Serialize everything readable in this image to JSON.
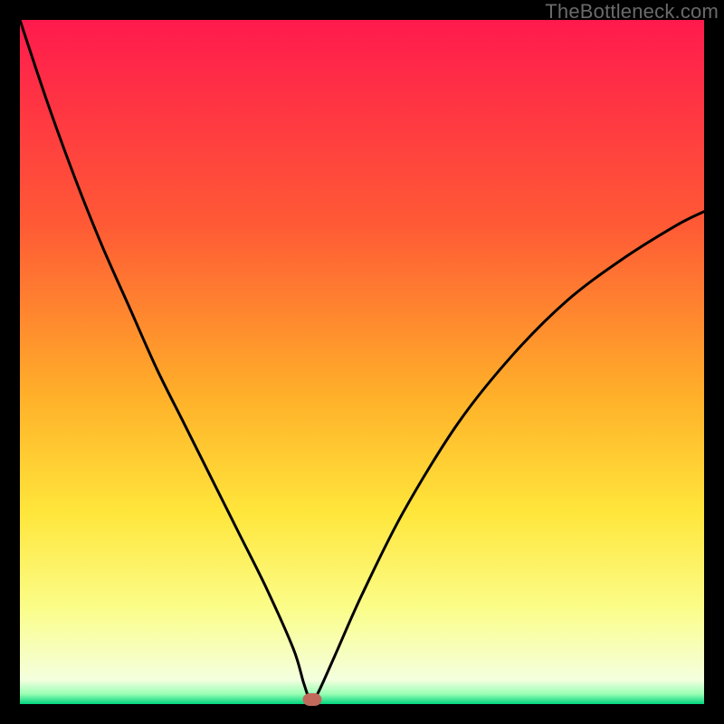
{
  "watermark": "TheBottleneck.com",
  "chart_data": {
    "type": "line",
    "title": "",
    "xlabel": "",
    "ylabel": "",
    "xlim": [
      0,
      100
    ],
    "ylim": [
      0,
      100
    ],
    "gradient_stops": [
      {
        "offset": 0,
        "color": "#ff1a4d"
      },
      {
        "offset": 0.3,
        "color": "#ff5a35"
      },
      {
        "offset": 0.55,
        "color": "#ffb029"
      },
      {
        "offset": 0.72,
        "color": "#ffe63b"
      },
      {
        "offset": 0.86,
        "color": "#fbfd89"
      },
      {
        "offset": 0.965,
        "color": "#f4ffdf"
      },
      {
        "offset": 0.985,
        "color": "#9affb4"
      },
      {
        "offset": 1.0,
        "color": "#00d47e"
      }
    ],
    "series": [
      {
        "name": "curve",
        "x": [
          0,
          4,
          8,
          12,
          16,
          20,
          24,
          28,
          32,
          36,
          40,
          41.5,
          42.5,
          43.5,
          46,
          50,
          56,
          64,
          72,
          80,
          88,
          96,
          100
        ],
        "y": [
          100,
          88,
          77,
          67,
          58,
          49,
          41,
          33,
          25,
          17,
          8,
          3,
          0.5,
          1.5,
          7,
          16,
          28,
          41,
          51,
          59,
          65,
          70,
          72
        ]
      }
    ],
    "marker": {
      "x": 42.7,
      "y": 0.6,
      "color": "#c16a5c"
    }
  }
}
